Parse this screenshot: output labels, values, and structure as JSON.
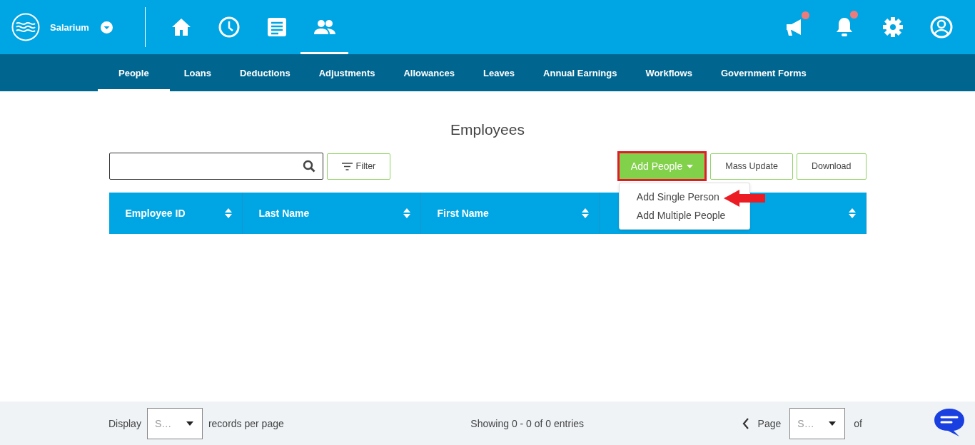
{
  "brand": {
    "name": "Salarium"
  },
  "nav_icons": [
    {
      "kind": "home",
      "selected": false
    },
    {
      "kind": "clock",
      "selected": false
    },
    {
      "kind": "document",
      "selected": false
    },
    {
      "kind": "people",
      "selected": true
    }
  ],
  "actions": [
    {
      "kind": "megaphone",
      "badge": true
    },
    {
      "kind": "bell",
      "badge": true
    },
    {
      "kind": "gear",
      "badge": false
    },
    {
      "kind": "user",
      "badge": false
    }
  ],
  "tabs": [
    {
      "label": "People",
      "selected": true
    },
    {
      "label": "Loans",
      "selected": false
    },
    {
      "label": "Deductions",
      "selected": false
    },
    {
      "label": "Adjustments",
      "selected": false
    },
    {
      "label": "Allowances",
      "selected": false
    },
    {
      "label": "Leaves",
      "selected": false
    },
    {
      "label": "Annual Earnings",
      "selected": false
    },
    {
      "label": "Workflows",
      "selected": false
    },
    {
      "label": "Government Forms",
      "selected": false
    }
  ],
  "page_title": "Employees",
  "filter_button": "Filter",
  "add_button": {
    "label": "Add People",
    "highlighted": true
  },
  "buttons": [
    "Mass Update",
    "Download"
  ],
  "dropdown": [
    {
      "label": "Add Single Person",
      "pointed": true
    },
    {
      "label": "Add Multiple People",
      "pointed": false
    }
  ],
  "table": {
    "columns": [
      "Employee ID",
      "Last Name",
      "First Name"
    ]
  },
  "footer": {
    "display_label": "Display",
    "per_page_value": "S…",
    "per_page_label": "records per page",
    "showing": "Showing 0 - 0 of 0 entries",
    "page_label": "Page",
    "page_value": "S…",
    "of_label": "of"
  }
}
